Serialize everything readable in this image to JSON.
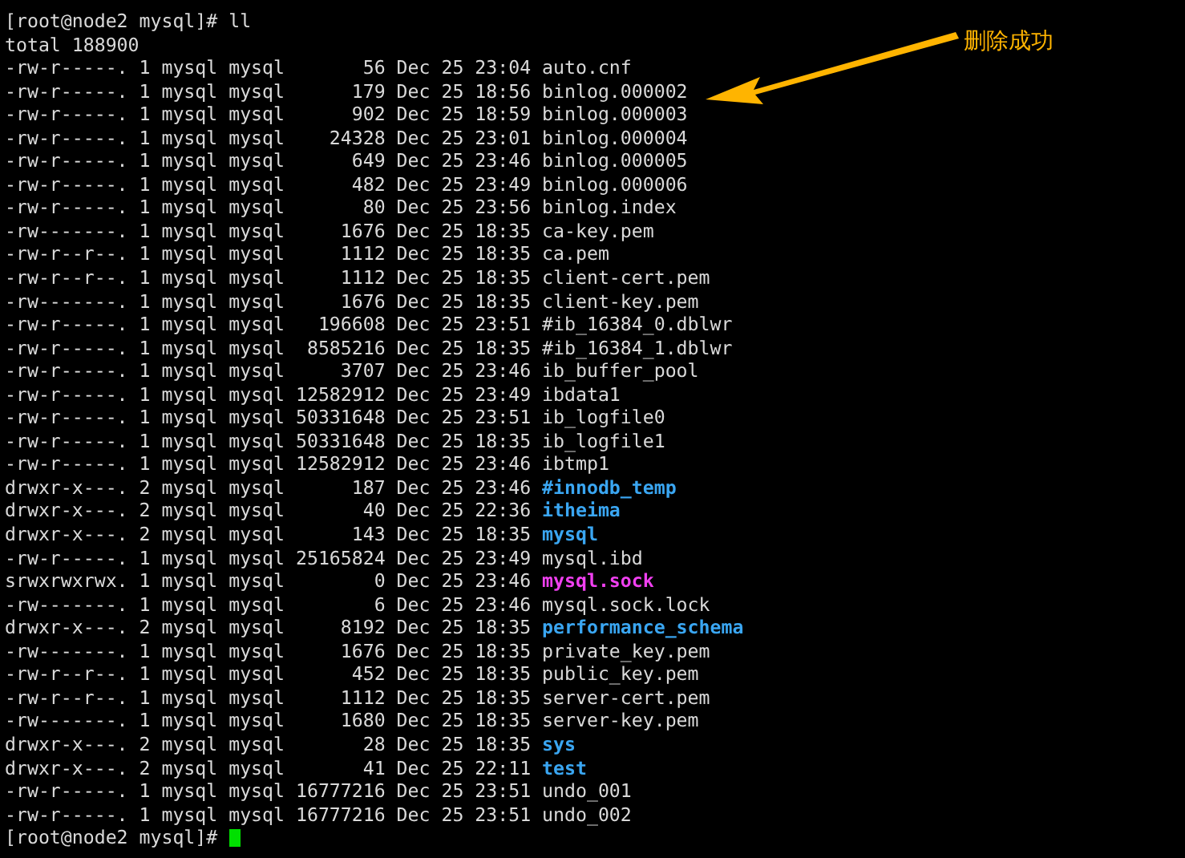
{
  "prompt": "[root@node2 mysql]# ll",
  "total": "total 188900",
  "rows": [
    {
      "info": "-rw-r-----. 1 mysql mysql       56 Dec 25 23:04",
      "name": "auto.cnf",
      "kind": "file"
    },
    {
      "info": "-rw-r-----. 1 mysql mysql      179 Dec 25 18:56",
      "name": "binlog.000002",
      "kind": "file"
    },
    {
      "info": "-rw-r-----. 1 mysql mysql      902 Dec 25 18:59",
      "name": "binlog.000003",
      "kind": "file"
    },
    {
      "info": "-rw-r-----. 1 mysql mysql    24328 Dec 25 23:01",
      "name": "binlog.000004",
      "kind": "file"
    },
    {
      "info": "-rw-r-----. 1 mysql mysql      649 Dec 25 23:46",
      "name": "binlog.000005",
      "kind": "file"
    },
    {
      "info": "-rw-r-----. 1 mysql mysql      482 Dec 25 23:49",
      "name": "binlog.000006",
      "kind": "file"
    },
    {
      "info": "-rw-r-----. 1 mysql mysql       80 Dec 25 23:56",
      "name": "binlog.index",
      "kind": "file"
    },
    {
      "info": "-rw-------. 1 mysql mysql     1676 Dec 25 18:35",
      "name": "ca-key.pem",
      "kind": "file"
    },
    {
      "info": "-rw-r--r--. 1 mysql mysql     1112 Dec 25 18:35",
      "name": "ca.pem",
      "kind": "file"
    },
    {
      "info": "-rw-r--r--. 1 mysql mysql     1112 Dec 25 18:35",
      "name": "client-cert.pem",
      "kind": "file"
    },
    {
      "info": "-rw-------. 1 mysql mysql     1676 Dec 25 18:35",
      "name": "client-key.pem",
      "kind": "file"
    },
    {
      "info": "-rw-r-----. 1 mysql mysql   196608 Dec 25 23:51",
      "name": "#ib_16384_0.dblwr",
      "kind": "file"
    },
    {
      "info": "-rw-r-----. 1 mysql mysql  8585216 Dec 25 18:35",
      "name": "#ib_16384_1.dblwr",
      "kind": "file"
    },
    {
      "info": "-rw-r-----. 1 mysql mysql     3707 Dec 25 23:46",
      "name": "ib_buffer_pool",
      "kind": "file"
    },
    {
      "info": "-rw-r-----. 1 mysql mysql 12582912 Dec 25 23:49",
      "name": "ibdata1",
      "kind": "file"
    },
    {
      "info": "-rw-r-----. 1 mysql mysql 50331648 Dec 25 23:51",
      "name": "ib_logfile0",
      "kind": "file"
    },
    {
      "info": "-rw-r-----. 1 mysql mysql 50331648 Dec 25 18:35",
      "name": "ib_logfile1",
      "kind": "file"
    },
    {
      "info": "-rw-r-----. 1 mysql mysql 12582912 Dec 25 23:46",
      "name": "ibtmp1",
      "kind": "file"
    },
    {
      "info": "drwxr-x---. 2 mysql mysql      187 Dec 25 23:46",
      "name": "#innodb_temp",
      "kind": "dir"
    },
    {
      "info": "drwxr-x---. 2 mysql mysql       40 Dec 25 22:36",
      "name": "itheima",
      "kind": "dir"
    },
    {
      "info": "drwxr-x---. 2 mysql mysql      143 Dec 25 18:35",
      "name": "mysql",
      "kind": "dir"
    },
    {
      "info": "-rw-r-----. 1 mysql mysql 25165824 Dec 25 23:49",
      "name": "mysql.ibd",
      "kind": "file"
    },
    {
      "info": "srwxrwxrwx. 1 mysql mysql        0 Dec 25 23:46",
      "name": "mysql.sock",
      "kind": "socket"
    },
    {
      "info": "-rw-------. 1 mysql mysql        6 Dec 25 23:46",
      "name": "mysql.sock.lock",
      "kind": "file"
    },
    {
      "info": "drwxr-x---. 2 mysql mysql     8192 Dec 25 18:35",
      "name": "performance_schema",
      "kind": "dir"
    },
    {
      "info": "-rw-------. 1 mysql mysql     1676 Dec 25 18:35",
      "name": "private_key.pem",
      "kind": "file"
    },
    {
      "info": "-rw-r--r--. 1 mysql mysql      452 Dec 25 18:35",
      "name": "public_key.pem",
      "kind": "file"
    },
    {
      "info": "-rw-r--r--. 1 mysql mysql     1112 Dec 25 18:35",
      "name": "server-cert.pem",
      "kind": "file"
    },
    {
      "info": "-rw-------. 1 mysql mysql     1680 Dec 25 18:35",
      "name": "server-key.pem",
      "kind": "file"
    },
    {
      "info": "drwxr-x---. 2 mysql mysql       28 Dec 25 18:35",
      "name": "sys",
      "kind": "dir"
    },
    {
      "info": "drwxr-x---. 2 mysql mysql       41 Dec 25 22:11",
      "name": "test",
      "kind": "dir"
    },
    {
      "info": "-rw-r-----. 1 mysql mysql 16777216 Dec 25 23:51",
      "name": "undo_001",
      "kind": "file"
    },
    {
      "info": "-rw-r-----. 1 mysql mysql 16777216 Dec 25 23:51",
      "name": "undo_002",
      "kind": "file"
    }
  ],
  "final_prompt": "[root@node2 mysql]#",
  "annotation": {
    "text": "删除成功"
  }
}
